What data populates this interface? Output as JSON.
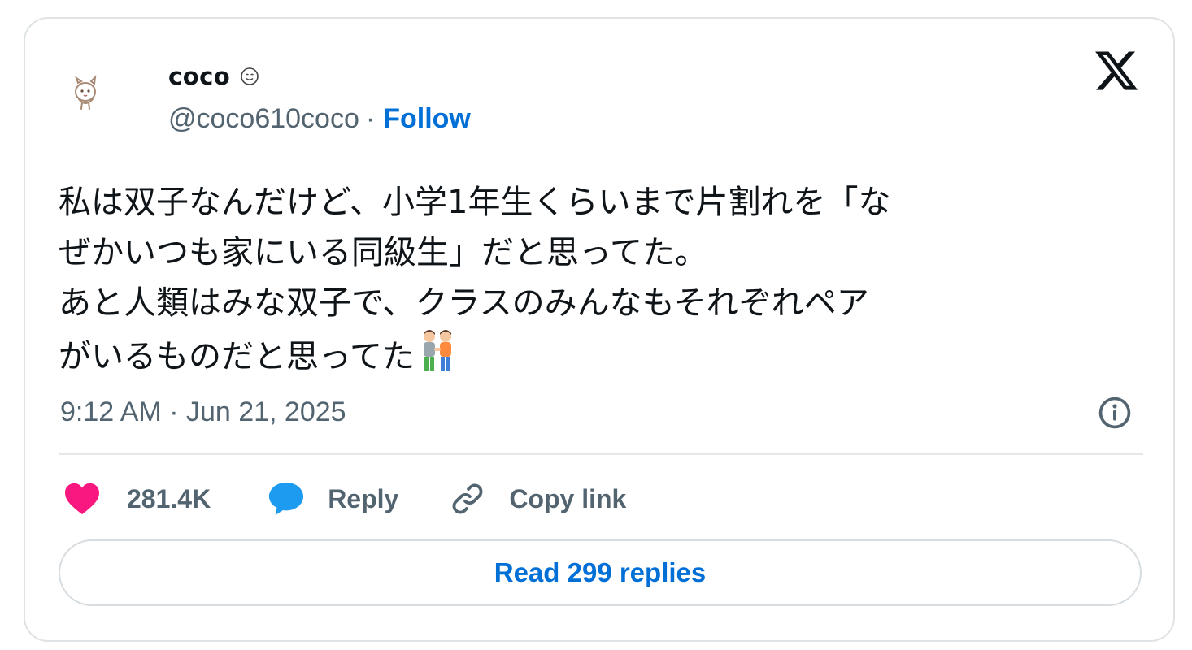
{
  "author": {
    "display_name": "coco",
    "name_emoji": "smiling-face-emoji",
    "handle": "@coco610coco",
    "separator": "·",
    "follow_label": "Follow"
  },
  "tweet": {
    "lines": [
      "私は双子なんだけど、小学1年生くらいまで片割れを「な",
      "ぜかいつも家にいる同級生」だと思ってた。",
      "あと人類はみな双子で、クラスのみんなもそれぞれペア",
      "がいるものだと思ってた"
    ],
    "trailing_emoji": "two-men-holding-hands-emoji"
  },
  "timestamp": "9:12 AM · Jun 21, 2025",
  "actions": {
    "likes_count": "281.4K",
    "reply_label": "Reply",
    "copy_link_label": "Copy link"
  },
  "read_replies_label": "Read 299 replies",
  "colors": {
    "link_blue": "#006fd6",
    "secondary_text": "#536471",
    "primary_text": "#0f1419",
    "like_pink": "#f91880",
    "reply_blue": "#1d9bf0"
  }
}
